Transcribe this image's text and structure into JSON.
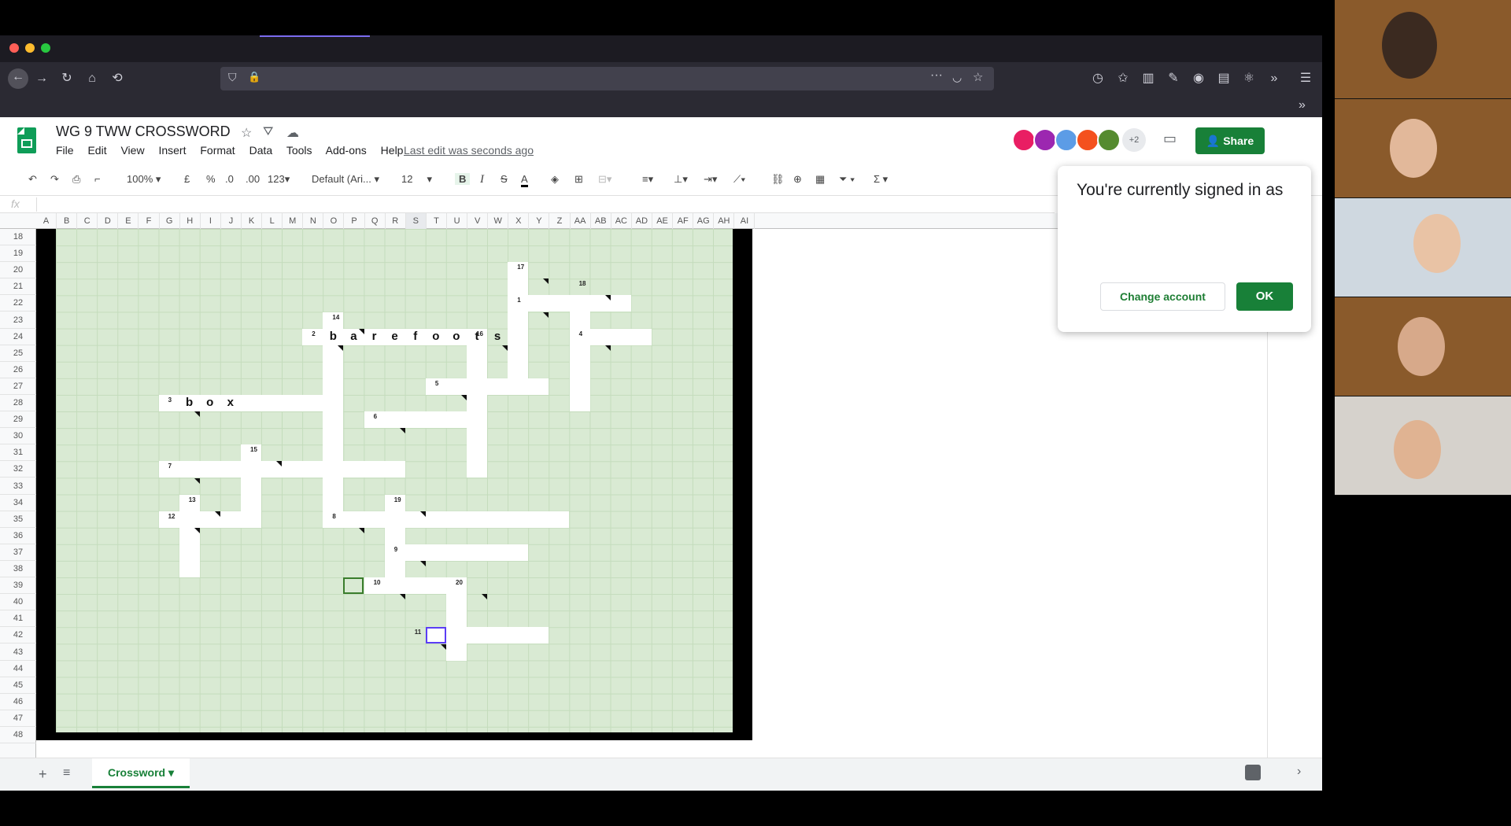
{
  "doc": {
    "title": "WG 9 TWW CROSSWORD",
    "menus": [
      "File",
      "Edit",
      "View",
      "Insert",
      "Format",
      "Data",
      "Tools",
      "Add-ons",
      "Help"
    ],
    "last_edit": "Last edit was seconds ago",
    "share_label": "Share",
    "collab_extra": "+2"
  },
  "toolbar": {
    "zoom": "100%",
    "currency": "£",
    "percent": "%",
    "dec_less": ".0",
    "dec_more": ".00",
    "format": "123",
    "font": "Default (Ari...",
    "size": "12",
    "bold": "B",
    "italic": "I",
    "strike": "S",
    "textcolor": "A",
    "sigma": "Σ"
  },
  "formula": {
    "fx": "fx",
    "value": ""
  },
  "columns": [
    "A",
    "B",
    "C",
    "D",
    "E",
    "F",
    "G",
    "H",
    "I",
    "J",
    "K",
    "L",
    "M",
    "N",
    "O",
    "P",
    "Q",
    "R",
    "S",
    "T",
    "U",
    "V",
    "W",
    "X",
    "Y",
    "Z",
    "AA",
    "AB",
    "AC",
    "AD",
    "AE",
    "AF",
    "AG",
    "AH",
    "AI"
  ],
  "rows": [
    "18",
    "19",
    "20",
    "21",
    "22",
    "23",
    "24",
    "25",
    "26",
    "27",
    "28",
    "29",
    "30",
    "31",
    "32",
    "33",
    "34",
    "35",
    "36",
    "37",
    "38",
    "39",
    "40",
    "41",
    "42",
    "43",
    "44",
    "45",
    "46",
    "47",
    "48"
  ],
  "crossword": {
    "numbers": [
      "1",
      "2",
      "3",
      "4",
      "5",
      "6",
      "7",
      "8",
      "9",
      "10",
      "11",
      "12",
      "13",
      "14",
      "15",
      "16",
      "17",
      "18",
      "19",
      "20"
    ],
    "word_barefoots": [
      "b",
      "a",
      "r",
      "e",
      "f",
      "o",
      "o",
      "t",
      "s"
    ],
    "word_box": [
      "b",
      "o",
      "x"
    ]
  },
  "popup": {
    "title": "You're currently signed in as",
    "change": "Change account",
    "ok": "OK"
  },
  "sheet": {
    "tab": "Crossword"
  },
  "colors": {
    "accent": "#188038",
    "grid": "#d9ead3"
  }
}
